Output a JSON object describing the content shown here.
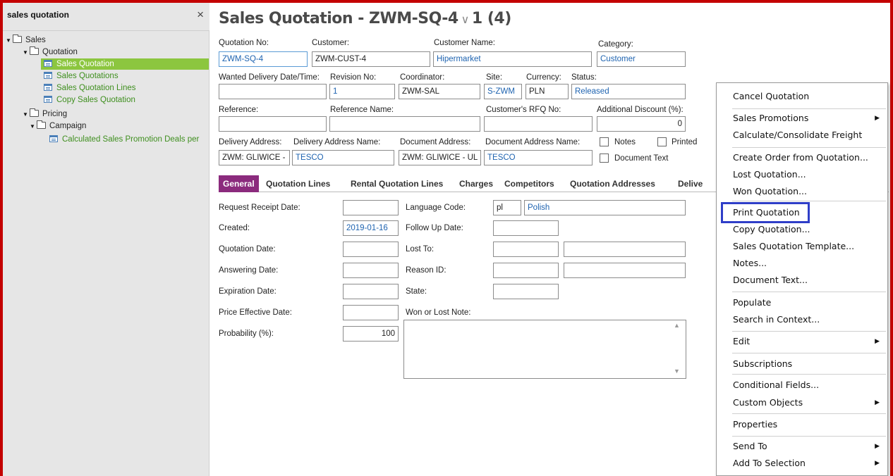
{
  "navigator": {
    "search_query": "sales quotation",
    "close_glyph": "×",
    "items": [
      {
        "label": "Sales"
      },
      {
        "label": "Quotation"
      },
      {
        "label": "Sales Quotation"
      },
      {
        "label": "Sales Quotations"
      },
      {
        "label": "Sales Quotation Lines"
      },
      {
        "label": "Copy Sales Quotation"
      },
      {
        "label": "Pricing"
      },
      {
        "label": "Campaign"
      },
      {
        "label": "Calculated Sales Promotion Deals per"
      }
    ]
  },
  "header": {
    "title_main": "Sales Quotation - ZWM-SQ-4",
    "chevron": "∨",
    "title_count": "1 (4)"
  },
  "form": {
    "quotation_no": {
      "label": "Quotation No:",
      "value": "ZWM-SQ-4"
    },
    "customer": {
      "label": "Customer:",
      "value": "ZWM-CUST-4"
    },
    "customer_name": {
      "label": "Customer Name:",
      "value": "Hipermarket"
    },
    "category": {
      "label": "Category:",
      "value": "Customer"
    },
    "wanted_delivery": {
      "label": "Wanted Delivery Date/Time:",
      "value": ""
    },
    "revision_no": {
      "label": "Revision No:",
      "value": "1"
    },
    "coordinator": {
      "label": "Coordinator:",
      "value": "ZWM-SAL"
    },
    "site": {
      "label": "Site:",
      "value": "S-ZWM"
    },
    "currency": {
      "label": "Currency:",
      "value": "PLN"
    },
    "status": {
      "label": "Status:",
      "value": "Released"
    },
    "reference": {
      "label": "Reference:",
      "value": ""
    },
    "reference_name": {
      "label": "Reference Name:",
      "value": ""
    },
    "customer_rfq": {
      "label": "Customer's RFQ No:",
      "value": ""
    },
    "additional_discount": {
      "label": "Additional Discount (%):",
      "value": "0"
    },
    "delivery_address": {
      "label": "Delivery Address:",
      "value": "ZWM: GLIWICE -"
    },
    "delivery_address_name": {
      "label": "Delivery Address Name:",
      "value": "TESCO"
    },
    "document_address": {
      "label": "Document Address:",
      "value": "ZWM: GLIWICE - UL"
    },
    "document_address_name": {
      "label": "Document Address Name:",
      "value": "TESCO"
    },
    "notes_label": "Notes",
    "printed_label": "Printed",
    "document_text_label": "Document Text"
  },
  "tabs": [
    "General",
    "Quotation Lines",
    "Rental Quotation Lines",
    "Charges",
    "Competitors",
    "Quotation Addresses",
    "Delive"
  ],
  "general": {
    "request_receipt_date": {
      "label": "Request Receipt Date:",
      "value": ""
    },
    "created": {
      "label": "Created:",
      "value": "2019-01-16"
    },
    "quotation_date": {
      "label": "Quotation Date:",
      "value": ""
    },
    "answering_date": {
      "label": "Answering Date:",
      "value": ""
    },
    "expiration_date": {
      "label": "Expiration Date:",
      "value": ""
    },
    "price_effective_date": {
      "label": "Price Effective Date:",
      "value": ""
    },
    "probability": {
      "label": "Probability (%):",
      "value": "100"
    },
    "language_code": {
      "label": "Language Code:",
      "value": "pl",
      "desc": "Polish"
    },
    "follow_up_date": {
      "label": "Follow Up Date:",
      "value": ""
    },
    "lost_to": {
      "label": "Lost To:",
      "value": ""
    },
    "reason_id": {
      "label": "Reason ID:",
      "value": ""
    },
    "state": {
      "label": "State:",
      "value": ""
    },
    "won_or_lost_note": {
      "label": "Won or Lost Note:",
      "value": ""
    }
  },
  "context_menu": {
    "items": [
      {
        "label": "Cancel Quotation"
      },
      {
        "label": "Sales Promotions",
        "submenu": true
      },
      {
        "label": "Calculate/Consolidate Freight"
      },
      {
        "label": "Create Order from Quotation..."
      },
      {
        "label": "Lost Quotation..."
      },
      {
        "label": "Won Quotation..."
      },
      {
        "label": "Print Quotation",
        "highlighted": true
      },
      {
        "label": "Copy Quotation..."
      },
      {
        "label": "Sales Quotation Template..."
      },
      {
        "label": "Notes..."
      },
      {
        "label": "Document Text..."
      },
      {
        "label": "Populate"
      },
      {
        "label": "Search in Context..."
      },
      {
        "label": "Edit",
        "submenu": true
      },
      {
        "label": "Subscriptions"
      },
      {
        "label": "Conditional Fields..."
      },
      {
        "label": "Custom Objects",
        "submenu": true
      },
      {
        "label": "Properties"
      },
      {
        "label": "Send To",
        "submenu": true
      },
      {
        "label": "Add To Selection",
        "submenu": true
      }
    ]
  },
  "colors": {
    "frame": "#c40000",
    "selected_nav": "#8cc63f",
    "active_tab": "#8b2b7d",
    "highlight_box": "#2f3ec8",
    "link": "#1e63b0"
  }
}
